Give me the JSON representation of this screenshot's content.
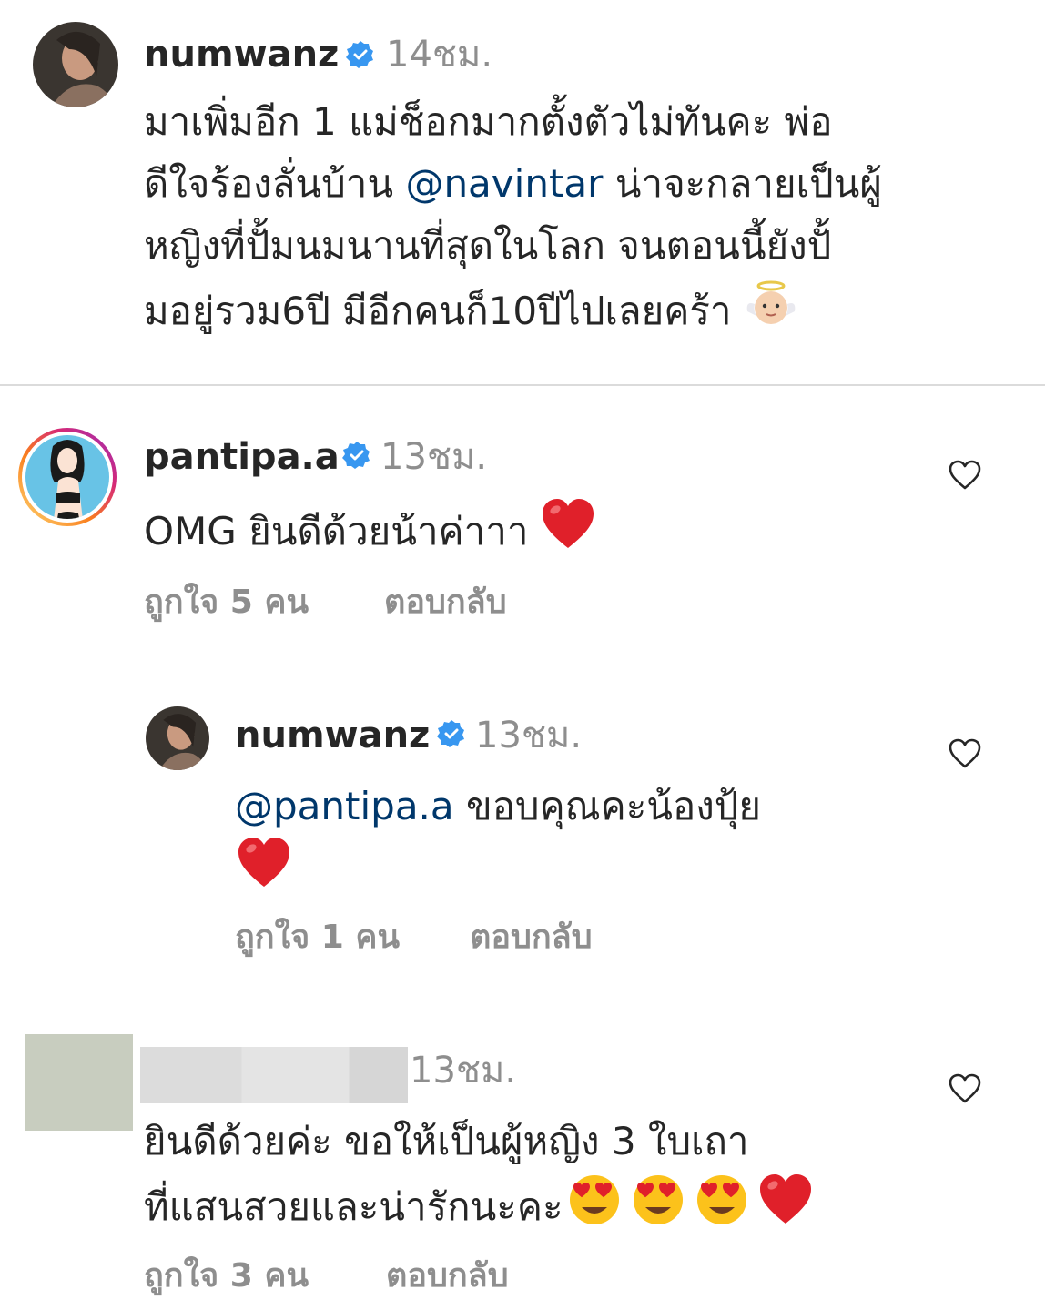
{
  "comments": [
    {
      "username": "numwanz",
      "time": "14ชม.",
      "line1": "มาเพิ่มอีก 1 แม่ช็อกมากตั้งตัวไม่ทันคะ พ่อ",
      "line2_pre": "ดีใจร้องลั่นบ้าน ",
      "line2_mention": "@navintar",
      "line2_post": " น่าจะกลายเป็นผู้",
      "line3": "หญิงที่ปั้มนมนานที่สุดในโลก จนตอนนี้ยังปั้",
      "line4": "มอยู่รวม6ปี มีอีกคนก็10ปีไปเลยคร้า",
      "emoji": "baby-angel"
    },
    {
      "username": "pantipa.a",
      "time": "13ชม.",
      "text": "OMG ยินดีด้วยน้าค่าาา",
      "emoji": "red-heart",
      "likes": "ถูกใจ 5 คน",
      "reply": "ตอบกลับ"
    },
    {
      "username": "numwanz",
      "time": "13ชม.",
      "mention": "@pantipa.a",
      "text": " ขอบคุณคะน้องปุ้ย",
      "emoji": "red-heart",
      "likes": "ถูกใจ 1 คน",
      "reply": "ตอบกลับ"
    },
    {
      "username_hidden": true,
      "time": "13ชม.",
      "line1": "ยินดีด้วยค่ะ ขอให้เป็นผู้หญิง 3 ใบเถา",
      "line2": "ที่แสนสวยและน่ารักนะคะ",
      "emojis": [
        "heart-eyes",
        "heart-eyes",
        "heart-eyes",
        "red-heart"
      ],
      "likes": "ถูกใจ 3 คน",
      "reply": "ตอบกลับ"
    }
  ],
  "colors": {
    "text": "#262626",
    "secondary": "#8e8e8e",
    "mention": "#00376b",
    "verified": "#3897f0",
    "divider": "#dbdbdb"
  }
}
